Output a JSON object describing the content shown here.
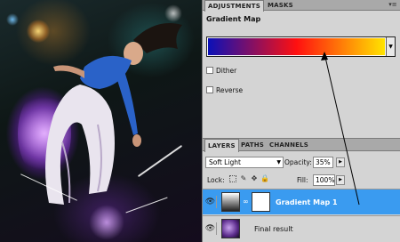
{
  "adjustments": {
    "tabs": [
      "ADJUSTMENTS",
      "MASKS"
    ],
    "title": "Gradient Map",
    "gradient": {
      "colors": [
        "#0a10b8",
        "#ff1010",
        "#ffe400"
      ]
    },
    "options": [
      "Dither",
      "Reverse"
    ]
  },
  "layers": {
    "tabs": [
      "LAYERS",
      "PATHS",
      "CHANNELS"
    ],
    "blend_mode": "Soft Light",
    "opacity_label": "Opacity:",
    "opacity_value": "35%",
    "lock_label": "Lock:",
    "fill_label": "Fill:",
    "fill_value": "100%",
    "items": [
      {
        "name": "Gradient Map 1",
        "selected": true
      },
      {
        "name": "Final result",
        "selected": false
      }
    ]
  },
  "icons": [
    "eye-icon",
    "chain-icon",
    "lock-icon",
    "move-icon",
    "brush-icon",
    "pixel-lock-icon",
    "dropdown-arrow-icon",
    "panel-menu-icon"
  ],
  "colors": {
    "selection": "#3a9bf0",
    "panel_bg": "#d4d4d4"
  }
}
